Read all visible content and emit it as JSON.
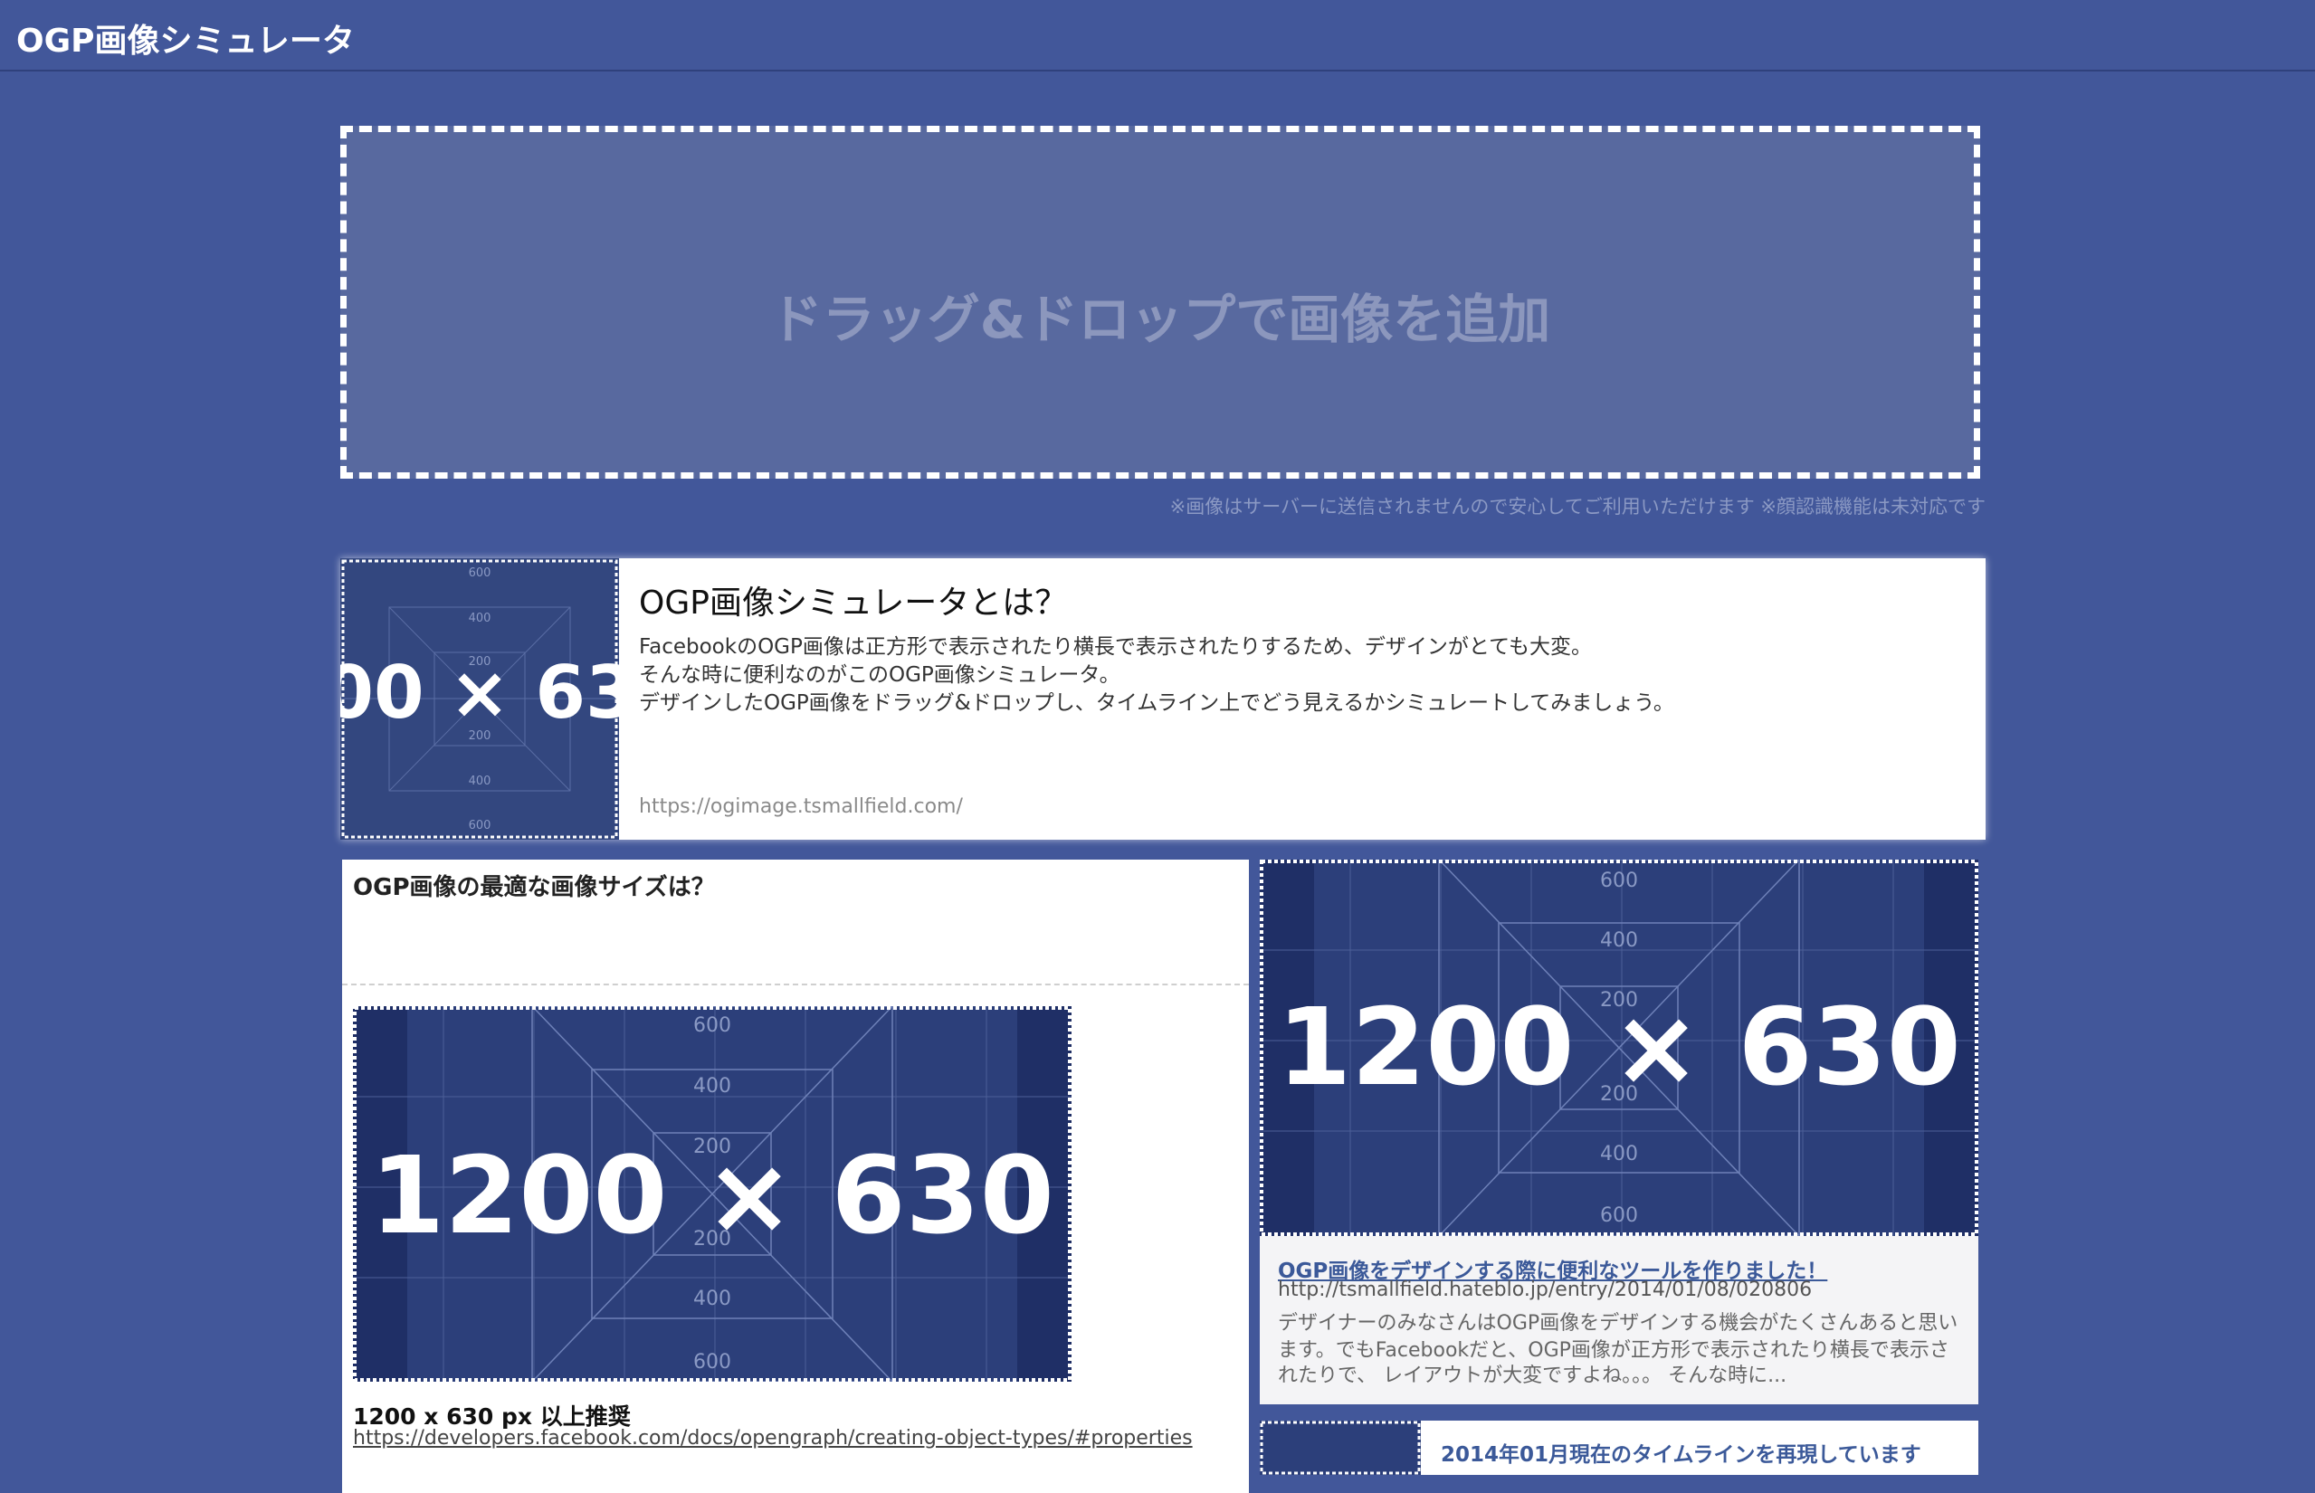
{
  "header": {
    "title": "OGP画像シミュレータ"
  },
  "dropzone": {
    "label": "ドラッグ&ドロップで画像を追加",
    "note": "※画像はサーバーに送信されませんので安心してご利用いただけます ※顔認識機能は未対応です"
  },
  "about": {
    "title": "OGP画像シミュレータとは？",
    "lines": [
      "FacebookのOGP画像は正方形で表示されたり横長で表示されたりするため、デザインがとても大変。",
      "そんな時に便利なのがこのOGP画像シミュレータ。",
      "デザインしたOGP画像をドラッグ&ドロップし、タイムライン上でどう見えるかシミュレートしてみましょう。"
    ],
    "url": "https://ogimage.tsmallfield.com/",
    "thumb_text": "00 × 63"
  },
  "size_card": {
    "title": "OGP画像の最適な画像サイズは？",
    "image_text": "1200 × 630",
    "size_text": "1200 x 630 px 以上推奨",
    "link": "https://developers.facebook.com/docs/opengraph/creating-object-types/#properties"
  },
  "blog_card": {
    "image_text": "1200 × 630",
    "title": "OGP画像をデザインする際に便利なツールを作りました！",
    "url": "http://tsmallfield.hateblo.jp/entry/2014/01/08/020806",
    "desc": [
      "デザイナーのみなさんはOGP画像をデザインする機会がたくさんあると思い",
      "ます。でもFacebookだと、OGP画像が正方形で表示されたり横長で表示さ",
      "れたりで、 レイアウトが大変ですよね。。。 そんな時に..."
    ]
  },
  "next_card": {
    "title": "2014年01月現在のタイムラインを再現しています"
  },
  "placeholder": {
    "labels": [
      "600",
      "400",
      "200"
    ],
    "colors": {
      "bg": "#2c3f7a",
      "bg_edge": "#1f2f66",
      "grid": "#6e81b8",
      "text": "#ffffff"
    }
  }
}
